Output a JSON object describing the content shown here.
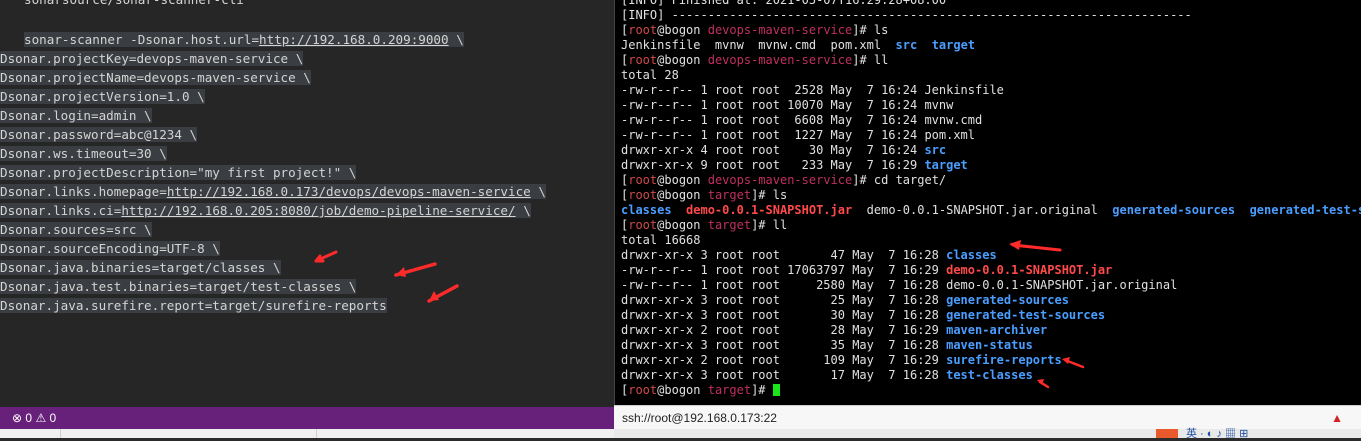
{
  "editor": {
    "lines": [
      "sonarsource/sonar-scanner-cli",
      "",
      "sonar-scanner -Dsonar.host.url=http://192.168.0.209:9000 \\",
      "Dsonar.projectKey=devops-maven-service \\",
      "Dsonar.projectName=devops-maven-service \\",
      "Dsonar.projectVersion=1.0 \\",
      "Dsonar.login=admin \\",
      "Dsonar.password=abc@1234 \\",
      "Dsonar.ws.timeout=30 \\",
      "Dsonar.projectDescription=\"my first project!\" \\",
      "Dsonar.links.homepage=http://192.168.0.173/devops/devops-maven-service \\",
      "Dsonar.links.ci=http://192.168.0.205:8080/job/demo-pipeline-service/ \\",
      "Dsonar.sources=src \\",
      "Dsonar.sourceEncoding=UTF-8 \\",
      "Dsonar.java.binaries=target/classes \\",
      "Dsonar.java.test.binaries=target/test-classes \\",
      "Dsonar.java.surefire.report=target/surefire-reports"
    ]
  },
  "statusbar": {
    "errors": "0",
    "warnings": "0",
    "error_icon": "circle-x-icon",
    "warning_icon": "triangle-warning-icon"
  },
  "terminal": {
    "top1": "[INFO] Finished at: 2021-05-07T16:29:28+08:00",
    "top2": "[INFO] ------------------------------------------------------------------------",
    "prompt_user": "root",
    "prompt_host": "@bogon ",
    "dir_service": "devops-maven-service",
    "dir_target": "target",
    "cmd_ls": "ls",
    "cmd_ll": "ll",
    "cmd_cd": "cd target/",
    "ls1_plain": "Jenkinsfile  mvnw  mvnw.cmd  pom.xml  ",
    "ls1_src": "src",
    "ls1_target": "target",
    "total1": "total 28",
    "ll1": [
      {
        "prefix": "-rw-r--r-- 1 root root  2528 May  7 16:24 ",
        "name": "Jenkinsfile",
        "kind": "file"
      },
      {
        "prefix": "-rw-r--r-- 1 root root 10070 May  7 16:24 ",
        "name": "mvnw",
        "kind": "file"
      },
      {
        "prefix": "-rw-r--r-- 1 root root  6608 May  7 16:24 ",
        "name": "mvnw.cmd",
        "kind": "file"
      },
      {
        "prefix": "-rw-r--r-- 1 root root  1227 May  7 16:24 ",
        "name": "pom.xml",
        "kind": "file"
      },
      {
        "prefix": "drwxr-xr-x 4 root root    30 May  7 16:24 ",
        "name": "src",
        "kind": "dir"
      },
      {
        "prefix": "drwxr-xr-x 9 root root   233 May  7 16:29 ",
        "name": "target",
        "kind": "dir"
      }
    ],
    "ls2": [
      {
        "name": "classes",
        "kind": "dir"
      },
      {
        "name": "demo-0.0.1-SNAPSHOT.jar",
        "kind": "jar"
      },
      {
        "name": "demo-0.0.1-SNAPSHOT.jar.original",
        "kind": "file"
      },
      {
        "name": "generated-sources",
        "kind": "dir"
      },
      {
        "name": "generated-test-sour",
        "kind": "dir"
      }
    ],
    "total2": "total 16668",
    "ll2": [
      {
        "prefix": "drwxr-xr-x 3 root root       47 May  7 16:28 ",
        "name": "classes",
        "kind": "dir"
      },
      {
        "prefix": "-rw-r--r-- 1 root root 17063797 May  7 16:29 ",
        "name": "demo-0.0.1-SNAPSHOT.jar",
        "kind": "jar"
      },
      {
        "prefix": "-rw-r--r-- 1 root root     2580 May  7 16:28 ",
        "name": "demo-0.0.1-SNAPSHOT.jar.original",
        "kind": "file"
      },
      {
        "prefix": "drwxr-xr-x 3 root root       25 May  7 16:28 ",
        "name": "generated-sources",
        "kind": "dir"
      },
      {
        "prefix": "drwxr-xr-x 3 root root       30 May  7 16:28 ",
        "name": "generated-test-sources",
        "kind": "dir"
      },
      {
        "prefix": "drwxr-xr-x 2 root root       28 May  7 16:29 ",
        "name": "maven-archiver",
        "kind": "dir"
      },
      {
        "prefix": "drwxr-xr-x 3 root root       35 May  7 16:28 ",
        "name": "maven-status",
        "kind": "dir"
      },
      {
        "prefix": "drwxr-xr-x 2 root root      109 May  7 16:29 ",
        "name": "surefire-reports",
        "kind": "dir"
      },
      {
        "prefix": "drwxr-xr-x 3 root root       17 May  7 16:28 ",
        "name": "test-classes",
        "kind": "dir"
      }
    ]
  },
  "ssh_bar": {
    "address": "ssh://root@192.168.0.173:22",
    "warning_icon": "warning-triangle-icon"
  },
  "taskbar": {
    "tray_text": "英 · ◐ ♪ ▦ ⊞",
    "ime_icon": "ime-s-icon"
  },
  "colors": {
    "accent_status": "#68217a",
    "arrow": "#ff2a2a",
    "dir": "#4a9eff",
    "jar": "#ff4a4a",
    "cursor": "#19e619"
  }
}
